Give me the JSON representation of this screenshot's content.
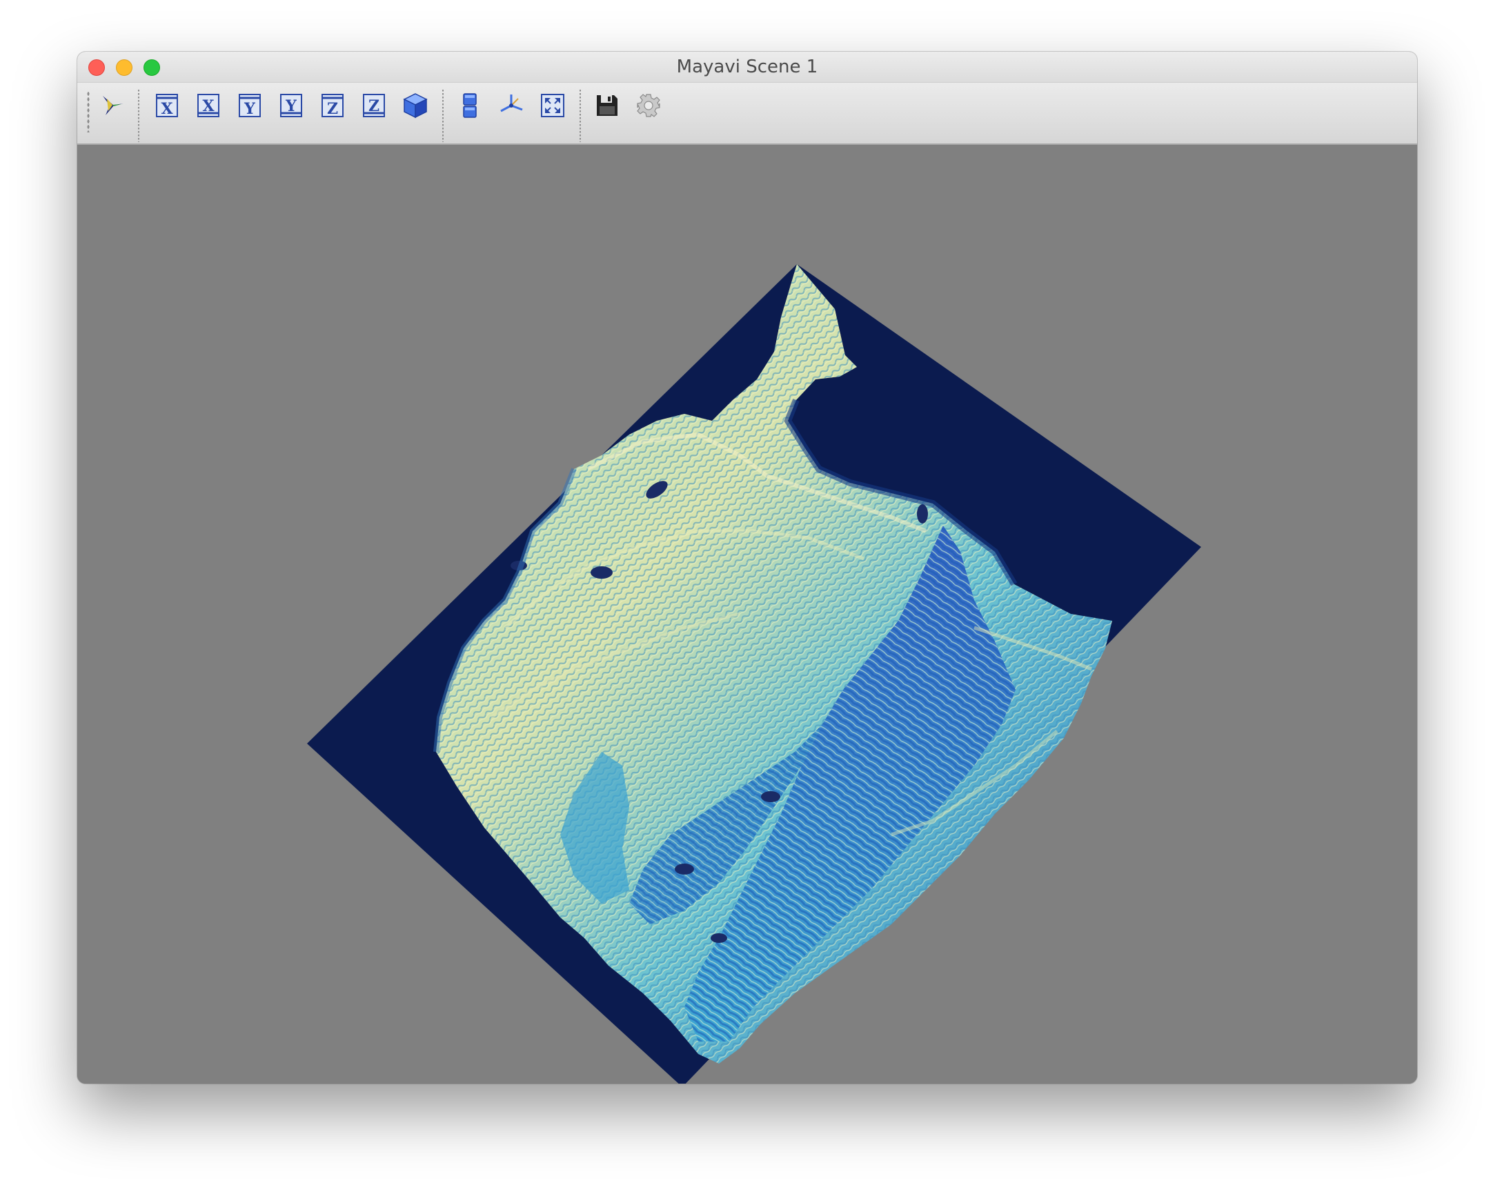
{
  "window": {
    "title": "Mayavi Scene 1"
  },
  "toolbar": {
    "buttons": [
      {
        "name": "mayavi-pipeline-button",
        "icon": "mayavi-pipeline-icon"
      },
      {
        "name": "view-x-positive-button",
        "icon": "x-axis-view-icon",
        "label": "X"
      },
      {
        "name": "view-x-negative-button",
        "icon": "x-axis-view-icon",
        "label": "X"
      },
      {
        "name": "view-y-positive-button",
        "icon": "y-axis-view-icon",
        "label": "Y"
      },
      {
        "name": "view-y-negative-button",
        "icon": "y-axis-view-icon",
        "label": "Y"
      },
      {
        "name": "view-z-positive-button",
        "icon": "z-axis-view-icon",
        "label": "Z"
      },
      {
        "name": "view-z-negative-button",
        "icon": "z-axis-view-icon",
        "label": "Z"
      },
      {
        "name": "isometric-view-button",
        "icon": "cube-icon"
      },
      {
        "name": "toggle-parallel-projection-button",
        "icon": "parallel-projection-icon"
      },
      {
        "name": "toggle-axes-indicator-button",
        "icon": "axes-indicator-icon"
      },
      {
        "name": "full-screen-button",
        "icon": "full-screen-icon"
      },
      {
        "name": "save-snapshot-button",
        "icon": "floppy-disk-icon"
      },
      {
        "name": "scene-settings-button",
        "icon": "gear-icon"
      }
    ]
  },
  "scene": {
    "background_color": "#808080",
    "ocean_color": "#0b1b4f",
    "colormap": [
      "#0b1b4f",
      "#1e4fa8",
      "#2f8fc7",
      "#57c2cf",
      "#9ddcc0",
      "#e6e8b0"
    ]
  }
}
